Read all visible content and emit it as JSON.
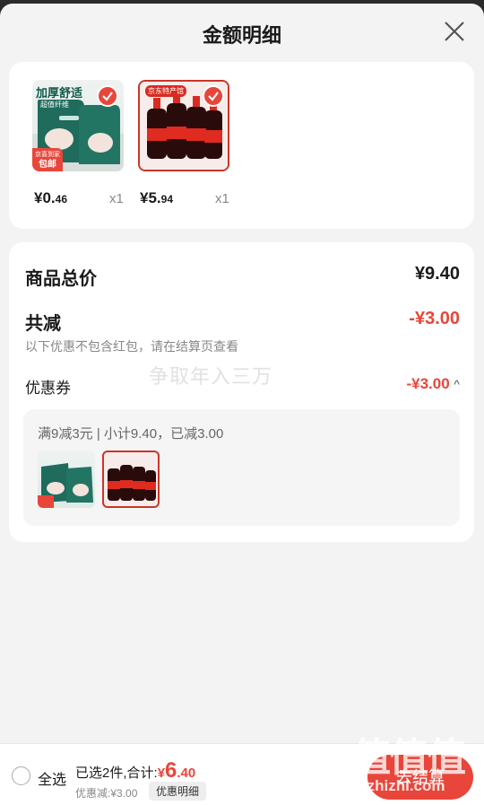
{
  "sheet": {
    "title": "金额明细"
  },
  "products": [
    {
      "name": "tissue-pack",
      "price_int": "¥0.",
      "price_dec": "46",
      "qty": "x1",
      "badge_top": "加厚舒适",
      "badge_tag": "超值纤维",
      "badge_bottom1": "京喜到家",
      "badge_bottom2": "包邮"
    },
    {
      "name": "cola-bottles",
      "price_int": "¥5.",
      "price_dec": "94",
      "qty": "x1",
      "badge_top": "京东特产馆"
    }
  ],
  "summary": {
    "total_label": "商品总价",
    "total_value": "¥9.40",
    "discount_label": "共减",
    "discount_value": "-¥3.00",
    "discount_note": "以下优惠不包含红包，请在结算页查看",
    "coupon_label": "优惠券",
    "coupon_value": "-¥3.00",
    "coupon_chevron": "^",
    "promo_desc": "满9减3元 | 小计9.40，已减3.00"
  },
  "watermark": "争取年入三万",
  "bottom": {
    "select_all": "全选",
    "selected_text": "已选2件,合计:",
    "total_yen": "¥",
    "total_int": "6",
    "total_dec": ".40",
    "discount_text": "优惠减:¥3.00",
    "detail_button": "优惠明细",
    "checkout_button": "去结算"
  },
  "site_mark": {
    "glyphs": "值值值",
    "url": "zhizhizhi.com"
  },
  "colors": {
    "accent": "#e8463a",
    "card_bg": "#ffffff",
    "sheet_bg": "#f3f3f3"
  }
}
